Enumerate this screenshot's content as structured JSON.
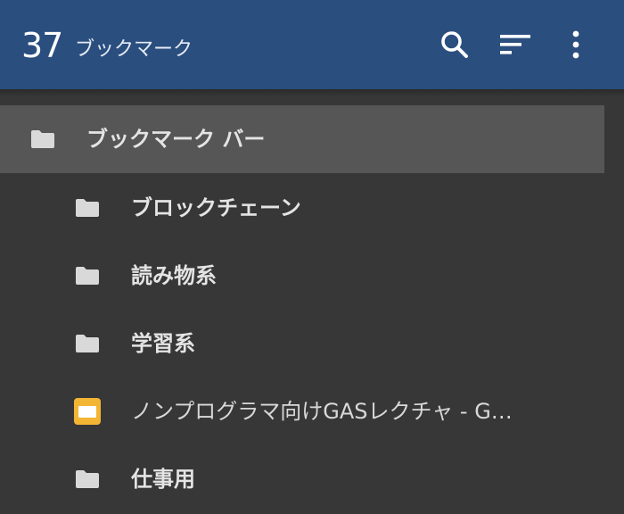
{
  "header": {
    "count": "37",
    "title": "ブックマーク",
    "search_icon": "search-icon",
    "sort_icon": "sort-icon",
    "more_icon": "more-vert-icon",
    "background": "#2a4e7e"
  },
  "tree": {
    "root": {
      "label": "ブックマーク バー",
      "icon": "folder-icon",
      "selected": true
    },
    "items": [
      {
        "label": "ブロックチェーン",
        "icon": "folder-icon",
        "type": "folder"
      },
      {
        "label": "読み物系",
        "icon": "folder-icon",
        "type": "folder"
      },
      {
        "label": "学習系",
        "icon": "folder-icon",
        "type": "folder"
      },
      {
        "label": "ノンプログラマ向けGASレクチャ - G…",
        "icon": "page-icon",
        "type": "bookmark"
      },
      {
        "label": "仕事用",
        "icon": "folder-icon",
        "type": "folder"
      }
    ]
  },
  "colors": {
    "background": "#373737",
    "selected_row": "#565656",
    "folder": "#d9d9d9",
    "bookmark_icon": "#f2b534"
  }
}
